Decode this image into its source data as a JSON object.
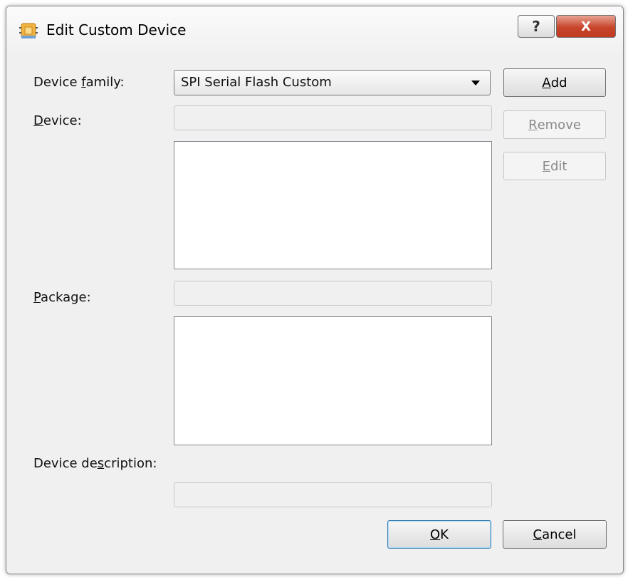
{
  "window": {
    "title": "Edit Custom Device",
    "help_glyph": "?",
    "close_glyph": "X"
  },
  "form": {
    "device_family": {
      "label_pre": "Device ",
      "label_ul": "f",
      "label_post": "amily:",
      "value": "SPI Serial Flash Custom"
    },
    "device": {
      "label_pre": "",
      "label_ul": "D",
      "label_post": "evice:"
    },
    "package": {
      "label_pre": "",
      "label_ul": "P",
      "label_post": "ackage:"
    },
    "description": {
      "label_pre": "Device de",
      "label_ul": "s",
      "label_post": "cription:"
    }
  },
  "buttons": {
    "add": {
      "ul": "A",
      "rest": "dd"
    },
    "remove": {
      "ul": "R",
      "rest": "emove"
    },
    "edit": {
      "ul": "E",
      "rest": "dit"
    },
    "ok": {
      "ul": "O",
      "rest": "K"
    },
    "cancel": {
      "ul": "C",
      "rest": "ancel"
    }
  },
  "icons": {
    "app": "chip-icon",
    "dropdown": "chevron-down-icon"
  }
}
